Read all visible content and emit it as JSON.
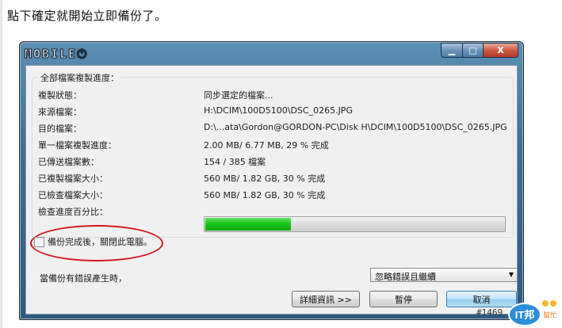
{
  "intro_text": "點下確定就開始立即備份了。",
  "window": {
    "logo_text": "MOBILE",
    "controls": {
      "minimize": "▁",
      "maximize": "□",
      "close": "X"
    }
  },
  "progress_group": {
    "title": "全部檔案複製進度：",
    "rows": [
      {
        "label": "複製狀態：",
        "value": "同步選定的檔案..."
      },
      {
        "label": "來源檔案：",
        "value": "H:\\DCIM\\100D5100\\DSC_0265.JPG"
      },
      {
        "label": "目的檔案：",
        "value": "D:\\...ata\\Gordon@GORDON-PC\\Disk H\\DCIM\\100D5100\\DSC_0265.JPG"
      },
      {
        "label": "單一檔案複製進度：",
        "value": "2.00 MB/ 6.77 MB,   29 % 完成"
      },
      {
        "label": "已傳送檔案數：",
        "value": "154 / 385 檔案"
      },
      {
        "label": "已複製檔案大小：",
        "value": "560 MB/ 1.82 GB,   30 % 完成"
      },
      {
        "label": "已檢查檔案大小：",
        "value": "560 MB/ 1.82 GB,   30 % 完成"
      },
      {
        "label": "檢查進度百分比：",
        "value": ""
      }
    ],
    "check_progress_fraction": 0.29
  },
  "shutdown_checkbox": {
    "label": "備份完成後，關閉此電腦。",
    "checked": false
  },
  "error_handling": {
    "label": "當備份有錯誤產生時，",
    "selected": "忽略錯誤且繼續"
  },
  "buttons": {
    "details": "詳細資訊 >>",
    "pause": "暫停",
    "cancel": "取消"
  },
  "watermark": {
    "id_text": "#1469",
    "logo_text": "IT邦",
    "logo_sub": "幫忙"
  },
  "colors": {
    "progress_fill": "#17c317",
    "annotation_ellipse": "#d7141b"
  }
}
